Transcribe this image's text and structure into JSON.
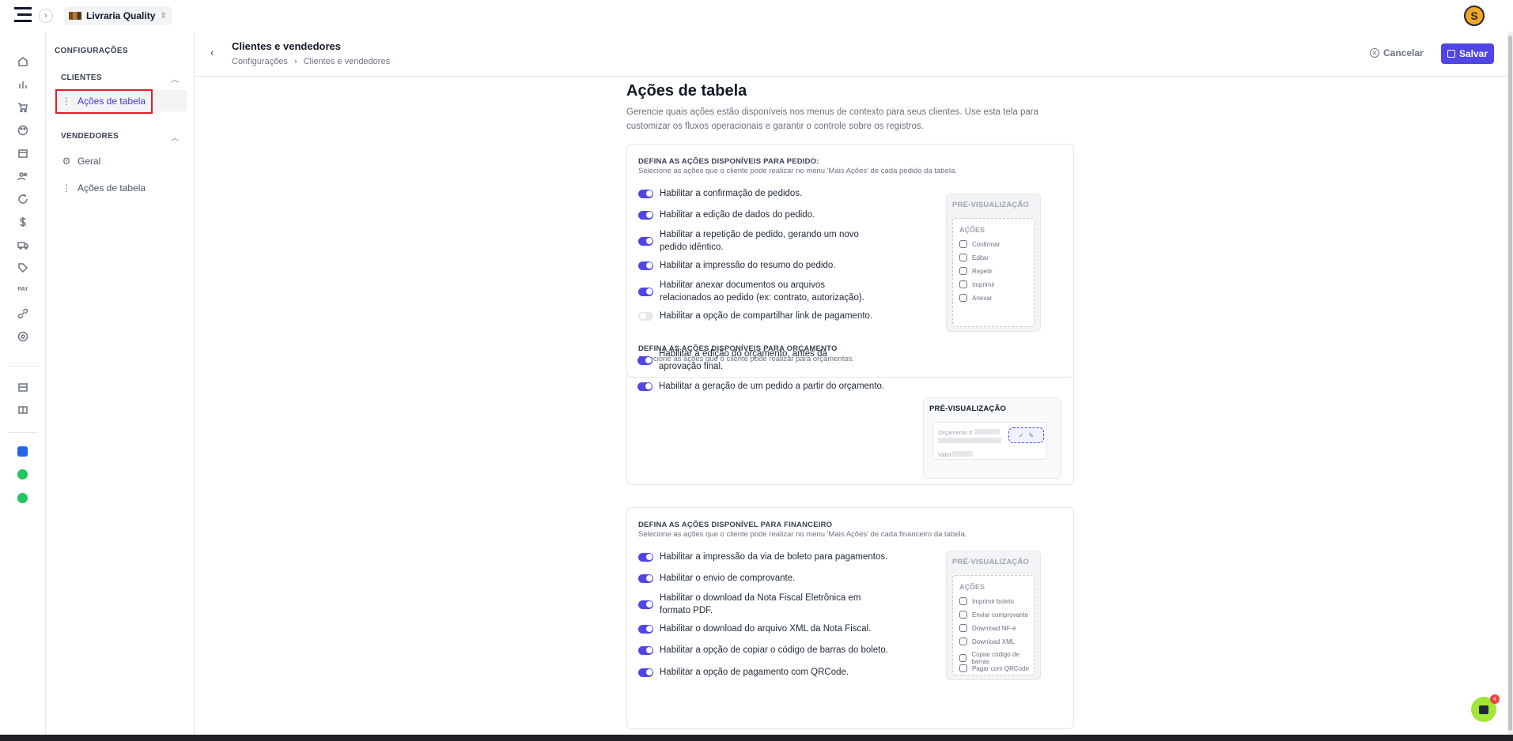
{
  "topbar": {
    "store_name": "Livraria Quality",
    "avatar_initial": "S"
  },
  "settings": {
    "title": "CONFIGURAÇÕES",
    "clientes_section": "CLIENTES",
    "clientes_items": [
      "Ações de tabela"
    ],
    "vendedores_section": "VENDEDORES",
    "vendedores_items": [
      "Geral",
      "Ações de tabela"
    ]
  },
  "header": {
    "title": "Clientes e vendedores",
    "breadcrumb": [
      "Configurações",
      "Clientes e vendedores"
    ],
    "cancel_label": "Cancelar",
    "save_label": "Salvar"
  },
  "page": {
    "title": "Ações de tabela",
    "description": "Gerencie quais ações estão disponíveis nos menus de contexto para seus clientes. Use esta tela para customizar os fluxos operacionais e garantir o controle sobre os registros."
  },
  "pedido": {
    "heading": "DEFINA AS AÇÕES DISPONÍVEIS PARA PEDIDO:",
    "subheading": "Selecione as ações que o cliente pode realizar no menu 'Mais Ações' de cada pedido da tabela.",
    "options": [
      {
        "label": "Habilitar a confirmação de pedidos.",
        "enabled": true
      },
      {
        "label": "Habilitar a edição de dados do pedido.",
        "enabled": true
      },
      {
        "label": "Habilitar a repetição de pedido, gerando um novo pedido idêntico.",
        "enabled": true
      },
      {
        "label": "Habilitar a impressão do resumo do pedido.",
        "enabled": true
      },
      {
        "label": "Habilitar anexar documentos ou arquivos relacionados ao pedido (ex: contrato, autorização).",
        "enabled": true
      },
      {
        "label": "Habilitar a opção de compartilhar link de pagamento.",
        "enabled": false
      }
    ],
    "preview_title": "PRÉ-VISUALIZAÇÃO",
    "preview_heading": "AÇÕES",
    "preview_actions": [
      "Confirmar",
      "Editar",
      "Repetir",
      "Imprimir",
      "Anexar"
    ]
  },
  "orcamento": {
    "heading": "DEFINA AS AÇÕES DISPONÍVEIS PARA ORÇAMENTO",
    "subheading": "Selecione as ações que o cliente pode realizar para orçamentos.",
    "options": [
      {
        "label": "Habilitar a edição do orçamento, antes da aprovação final.",
        "enabled": true
      },
      {
        "label": "Habilitar a geração de um pedido a partir do orçamento.",
        "enabled": true
      }
    ],
    "preview_title": "PRÉ-VISUALIZAÇÃO",
    "quote_label": "Orçamento #",
    "value_label": "Valor:"
  },
  "financeiro": {
    "heading": "DEFINA AS AÇÕES DISPONÍVEL PARA FINANCEIRO",
    "subheading": "Selecione as ações que o cliente pode realizar no menu 'Mais Ações' de cada financeiro da tabela.",
    "options": [
      {
        "label": "Habilitar a impressão da via de boleto para pagamentos.",
        "enabled": true
      },
      {
        "label": "Habilitar o envio de comprovante.",
        "enabled": true
      },
      {
        "label": "Habilitar o download da Nota Fiscal Eletrônica em formato PDF.",
        "enabled": true
      },
      {
        "label": "Habilitar o download do arquivo XML da Nota Fiscal.",
        "enabled": true
      },
      {
        "label": "Habilitar a opção de copiar o código de barras do boleto.",
        "enabled": true
      },
      {
        "label": "Habilitar a opção de pagamento com QRCode.",
        "enabled": true
      }
    ],
    "preview_title": "PRÉ-VISUALIZAÇÃO",
    "preview_heading": "AÇÕES",
    "preview_actions": [
      "Imprimir boleto",
      "Enviar comprovante",
      "Download NF-e",
      "Download XML",
      "Copiar código de barras",
      "Pagar com QRCode"
    ]
  },
  "chat": {
    "badge": "4"
  },
  "colors": {
    "accent": "#4f46e5",
    "highlight": "#e11d2a",
    "chat": "#a3e635"
  }
}
